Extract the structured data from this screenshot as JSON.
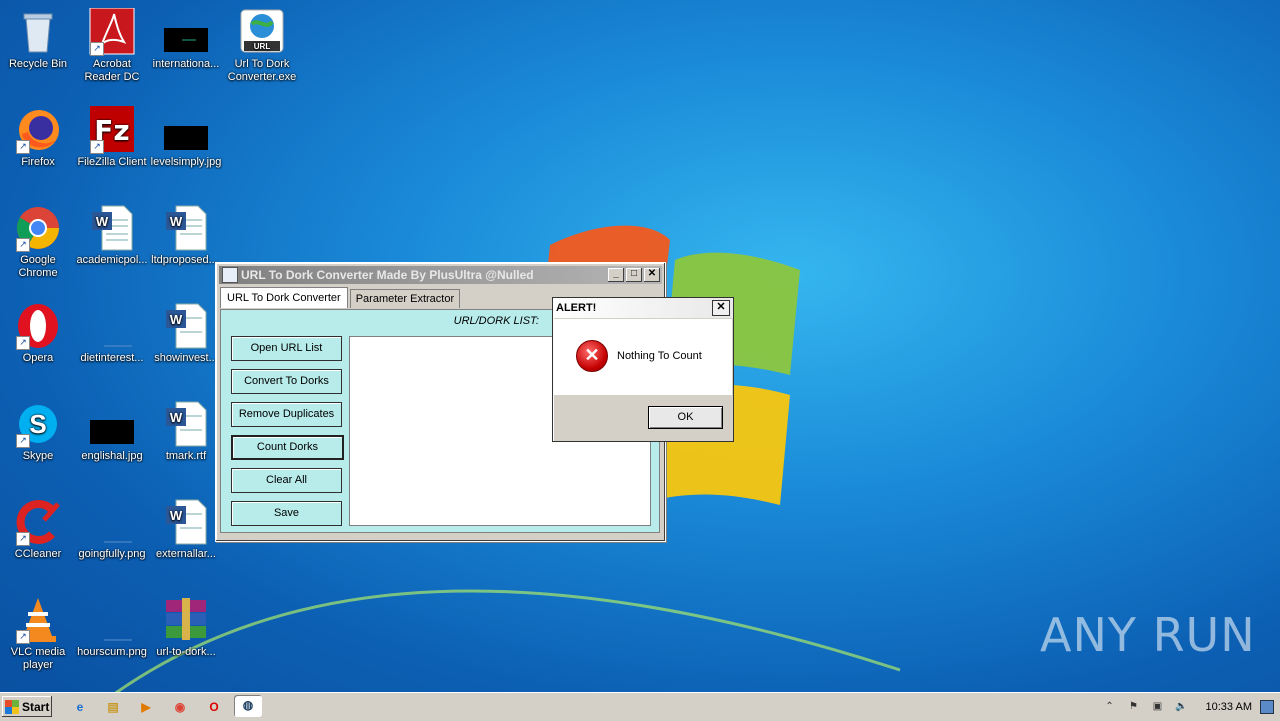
{
  "desktop": {
    "icons": [
      {
        "label": "Recycle Bin"
      },
      {
        "label": "Acrobat Reader DC"
      },
      {
        "label": "internationa..."
      },
      {
        "label": "Url To Dork Converter.exe"
      },
      {
        "label": "Firefox"
      },
      {
        "label": "FileZilla Client"
      },
      {
        "label": "levelsimply.jpg"
      },
      {
        "label": "Google Chrome"
      },
      {
        "label": "academicpol..."
      },
      {
        "label": "ltdproposed...."
      },
      {
        "label": "Opera"
      },
      {
        "label": "dietinterest..."
      },
      {
        "label": "showinvest..."
      },
      {
        "label": "Skype"
      },
      {
        "label": "englishal.jpg"
      },
      {
        "label": "tmark.rtf"
      },
      {
        "label": "CCleaner"
      },
      {
        "label": "goingfully.png"
      },
      {
        "label": "externallar..."
      },
      {
        "label": "VLC media player"
      },
      {
        "label": "hourscum.png"
      },
      {
        "label": "url-to-dork..."
      }
    ]
  },
  "app_window": {
    "title": "URL To Dork Converter Made By PlusUltra @Nulled",
    "tabs": [
      "URL To Dork Converter",
      "Parameter Extractor"
    ],
    "list_label": "URL/DORK LIST:",
    "buttons": [
      "Open URL List",
      "Convert To Dorks",
      "Remove Duplicates",
      "Count Dorks",
      "Clear All",
      "Save"
    ]
  },
  "alert": {
    "title": "ALERT!",
    "message": "Nothing To Count",
    "ok_label": "OK"
  },
  "taskbar": {
    "start_label": "Start",
    "clock": "10:33 AM"
  },
  "watermark": "ANY RUN"
}
